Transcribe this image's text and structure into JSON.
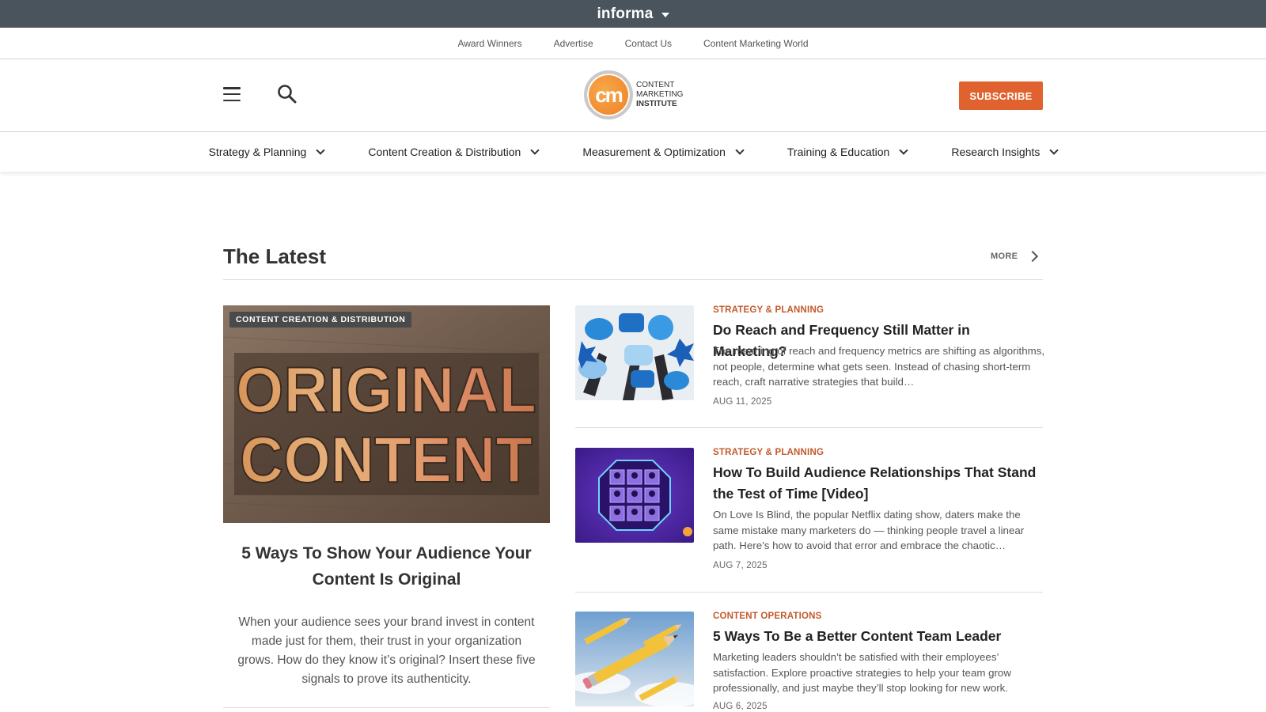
{
  "informa": {
    "logo": "informa"
  },
  "utility_nav": [
    "Award Winners",
    "Advertise",
    "Contact Us",
    "Content Marketing World"
  ],
  "header": {
    "brand_badge": "cm",
    "brand_lines": [
      "CONTENT",
      "MARKETING",
      "INSTITUTE"
    ],
    "subscribe_label": "SUBSCRIBE"
  },
  "main_nav": [
    "Strategy & Planning",
    "Content Creation & Distribution",
    "Measurement & Optimization",
    "Training & Education",
    "Research Insights"
  ],
  "section": {
    "title": "The Latest",
    "more_label": "MORE"
  },
  "featured": {
    "tag": "CONTENT CREATION & DISTRIBUTION",
    "image_text": [
      "ORIGINAL",
      "CONTENT"
    ],
    "title": "5 Ways To Show Your Audience Your Content Is Original",
    "description": "When your audience sees your brand invest in content made just for them, their trust in your organization grows. How do they know it’s original? Insert these five signals to prove its authenticity."
  },
  "articles": [
    {
      "category": "STRATEGY & PLANNING",
      "title": "Do Reach and Frequency Still Matter in Marketing?",
      "description": "The meaning of reach and frequency metrics are shifting as algorithms, not people, determine what gets seen. Instead of chasing short-term reach, craft narrative strategies that build…",
      "date": "AUG 11, 2025"
    },
    {
      "category": "STRATEGY & PLANNING",
      "title": "How To Build Audience Relationships That Stand the Test of Time [Video]",
      "description": "On Love Is Blind, the popular Netflix dating show, daters make the same mistake many marketers do — thinking people travel a linear path. Here’s how to avoid that error and embrace the chaotic…",
      "date": "AUG 7, 2025"
    },
    {
      "category": "CONTENT OPERATIONS",
      "title": "5 Ways To Be a Better Content Team Leader",
      "description": "Marketing leaders shouldn’t be satisfied with their employees’ satisfaction. Explore proactive strategies to help your team grow professionally, and just maybe they’ll stop looking for new work.",
      "date": "AUG 6, 2025"
    }
  ]
}
